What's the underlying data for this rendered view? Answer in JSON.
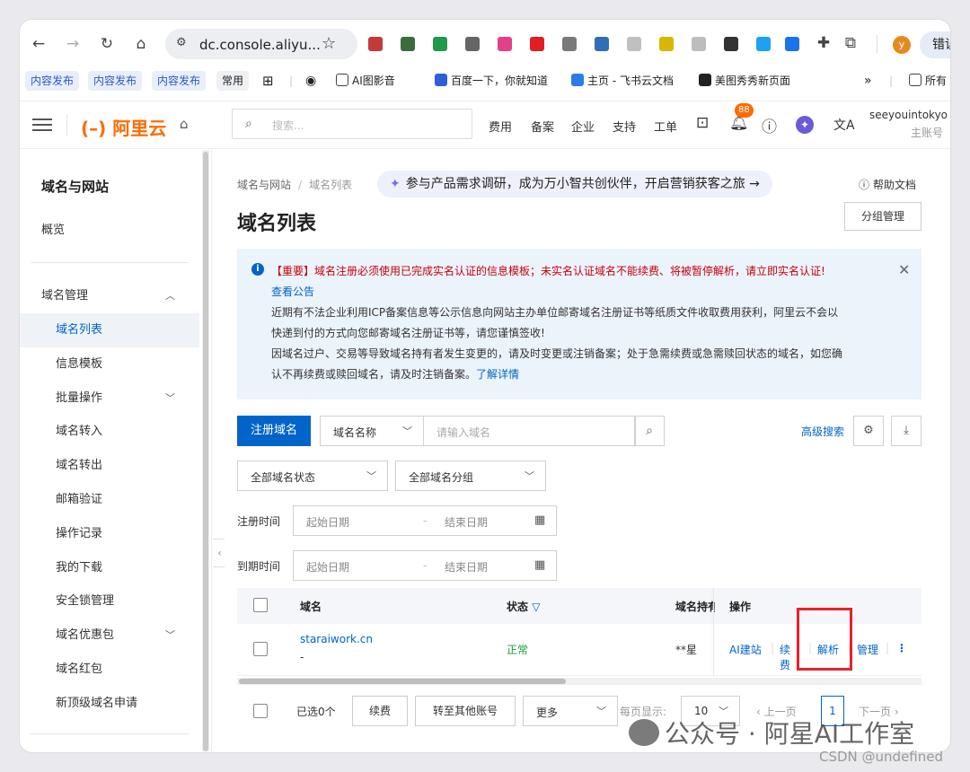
{
  "browser": {
    "url": "dc.console.aliyu...",
    "right_button": "错误",
    "bookmarks": [
      "内容发布",
      "内容发布",
      "内容发布",
      "常用",
      "AI图影音",
      "百度一下，你就知道",
      "主页 - 飞书云文档",
      "美图秀秀新页面"
    ],
    "bookmark_overflow": "»",
    "bookmark_folder": "所有",
    "profile_initial": "y",
    "extension_colors": [
      "#c23b3b",
      "#3b6d3b",
      "#1f9a4a",
      "#666666",
      "#e3408a",
      "#e02020",
      "#7a7a7a",
      "#2f6fb5",
      "#c0c0c0",
      "#d8b700",
      "#bdbdbd",
      "#333333",
      "#1ea1f2",
      "#1a73e8"
    ]
  },
  "topbar": {
    "logo": "(–) 阿里云",
    "search_placeholder": "搜索...",
    "nav": [
      "费用",
      "备案",
      "企业",
      "支持",
      "工单"
    ],
    "notif_count": "88",
    "account_name": "seeyouintokyo",
    "account_type": "主账号"
  },
  "sidebar": {
    "section_title": "域名与网站",
    "overview": "概览",
    "group": "域名管理",
    "items": [
      "域名列表",
      "信息模板",
      "批量操作",
      "域名转入",
      "域名转出",
      "邮箱验证",
      "操作记录",
      "我的下载",
      "安全锁管理",
      "域名优惠包",
      "域名红包",
      "新顶级域名申请"
    ],
    "active_index": 0
  },
  "main": {
    "breadcrumb": [
      "域名与网站",
      "域名列表"
    ],
    "promo": "参与产品需求调研，成为万小智共创伙伴，开启营销获客之旅 →",
    "help": "帮助文档",
    "title": "域名列表",
    "group_manage": "分组管理",
    "notice": {
      "important": "【重要】域名注册必须使用已完成实名认证的信息模板；未实名认证域名不能续费、将被暂停解析，请立即实名认证!",
      "announce": "查看公告",
      "line1": "近期有不法企业利用ICP备案信息等公示信息向网站主办单位邮寄域名注册证书等纸质文件收取费用获利，阿里云不会以",
      "line2": "快递到付的方式向您邮寄域名注册证书等，请您谨慎签收!",
      "line3": "因域名过户、交易等导致域名持有者发生变更的，请及时变更或注销备案；处于急需续费或急需赎回状态的域名，如您确",
      "line4": "认不再续费或赎回域名，请及时注销备案。",
      "learn_more": "了解详情"
    },
    "register_btn": "注册域名",
    "search_type": "域名名称",
    "search_placeholder": "请输入域名",
    "advanced_search": "高级搜索",
    "filter_status": "全部域名状态",
    "filter_group": "全部域名分组",
    "reg_time_label": "注册时间",
    "exp_time_label": "到期时间",
    "start_date": "起始日期",
    "end_date": "结束日期",
    "date_sep": "-",
    "table": {
      "headers": [
        "域名",
        "状态",
        "域名持有",
        "操作"
      ],
      "row": {
        "domain": "staraiwork.cn",
        "sub": "-",
        "status": "正常",
        "holder": "**星",
        "ops": [
          "AI建站",
          "续费",
          "解析",
          "管理"
        ],
        "more": "⋮"
      }
    },
    "footer": {
      "selected": "已选0个",
      "renew": "续费",
      "transfer": "转至其他账号",
      "more": "更多",
      "page_size_label": "每页显示:",
      "page_size": "10",
      "prev": "上一页",
      "page": "1",
      "next": "下一页"
    }
  },
  "watermark": "公众号 · 阿星AI工作室",
  "csdn": "CSDN @undefined"
}
